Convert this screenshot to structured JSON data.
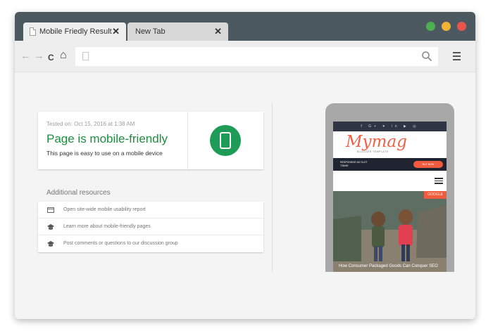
{
  "browser": {
    "tabs": [
      {
        "label": "Mobile Friedly Result",
        "active": true
      },
      {
        "label": "New Tab",
        "active": false
      }
    ],
    "close_glyph": "✕",
    "window_controls": [
      {
        "name": "maximize",
        "color": "#4caf50"
      },
      {
        "name": "minimize",
        "color": "#f2b233"
      },
      {
        "name": "close",
        "color": "#e9554b"
      }
    ],
    "nav": {
      "back_glyph": "←",
      "forward_glyph": "→",
      "reload_glyph": "C",
      "home_glyph": "⌂"
    },
    "address": {
      "value": ""
    }
  },
  "result": {
    "tested_on": "Tested on: Oct 15, 2016 at 1:38 AM",
    "headline": "Page is mobile-friendly",
    "subline": "This page is easy to use on a mobile device",
    "accent_color": "#1e9b57"
  },
  "additional_resources": {
    "heading": "Additional resources",
    "items": [
      {
        "label": "Open site-wide mobile usability report",
        "icon": "report-icon"
      },
      {
        "label": "Learn more about mobile-friendly pages",
        "icon": "school-icon"
      },
      {
        "label": "Post comments or questions to our discussion group",
        "icon": "school-icon"
      }
    ]
  },
  "preview": {
    "social_icons": "f G+ ♥ in ▶ ◎",
    "logo": "Mymag",
    "logo_sub": "BLOGGER TEMPLATE",
    "ad_text_line1": "RESPONSIVE AD SLOT",
    "ad_text_line2": "728x90",
    "ad_button": "BUY NOW",
    "tag": "GOOGLE",
    "caption": "How Consumer Packaged Goods Can Conquer SEO",
    "brand_color": "#ef5b3c"
  }
}
